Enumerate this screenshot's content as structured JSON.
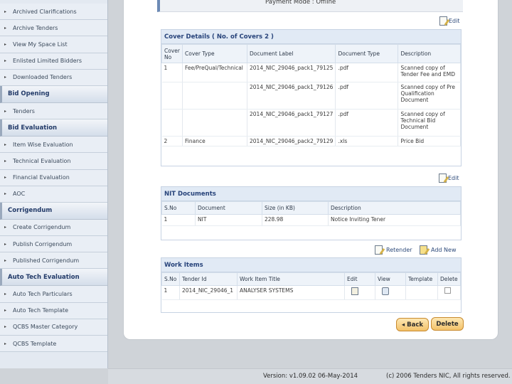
{
  "sidebar": {
    "group1": [
      {
        "label": "Archived Clarifications"
      },
      {
        "label": "Archive Tenders"
      },
      {
        "label": "View My Space List"
      },
      {
        "label": "Enlisted Limited Bidders"
      },
      {
        "label": "Downloaded Tenders"
      }
    ],
    "bid_opening": {
      "heading": "Bid Opening",
      "items": [
        {
          "label": "Tenders"
        }
      ]
    },
    "bid_evaluation": {
      "heading": "Bid Evaluation",
      "items": [
        {
          "label": "Item Wise Evaluation"
        },
        {
          "label": "Technical Evaluation"
        },
        {
          "label": "Financial Evaluation"
        },
        {
          "label": "AOC"
        }
      ]
    },
    "corrigendum": {
      "heading": "Corrigendum",
      "items": [
        {
          "label": "Create Corrigendum"
        },
        {
          "label": "Publish Corrigendum"
        },
        {
          "label": "Published Corrigendum"
        }
      ]
    },
    "auto_tech": {
      "heading": "Auto Tech Evaluation",
      "items": [
        {
          "label": "Auto Tech Particulars"
        },
        {
          "label": "Auto Tech Template"
        },
        {
          "label": "QCBS Master Category"
        },
        {
          "label": "QCBS Template"
        }
      ]
    }
  },
  "payment_mode": "Payment Mode : Offline",
  "cover": {
    "edit_label": "Edit",
    "title": "Cover Details ( No. of Covers 2 )",
    "headers": [
      "Cover No",
      "Cover Type",
      "Document Label",
      "Document Type",
      "Description"
    ],
    "rows": [
      {
        "no": "1",
        "type": "Fee/PreQual/Technical",
        "label": "2014_NIC_29046_pack1_79125",
        "doctype": ".pdf",
        "desc": [
          "Scanned copy of",
          "Tender Fee and EMD"
        ]
      },
      {
        "no": "",
        "type": "",
        "label": "2014_NIC_29046_pack1_79126",
        "doctype": ".pdf",
        "desc": [
          "Scanned copy of Pre",
          "Qualification",
          "Document"
        ]
      },
      {
        "no": "",
        "type": "",
        "label": "2014_NIC_29046_pack1_79127",
        "doctype": ".pdf",
        "desc": [
          "Scanned copy of",
          "Technical Bid",
          "Document"
        ]
      },
      {
        "no": "2",
        "type": "Finance",
        "label": "2014_NIC_29046_pack2_79129",
        "doctype": ".xls",
        "desc": [
          "Price Bid"
        ]
      }
    ]
  },
  "nit": {
    "edit_label": "Edit",
    "title": "NIT Documents",
    "headers": [
      "S.No",
      "Document",
      "Size (in KB)",
      "Description"
    ],
    "rows": [
      {
        "sno": "1",
        "doc": "NIT",
        "size": "228.98",
        "desc": "Notice Inviting Tener"
      }
    ]
  },
  "work": {
    "retender_label": "Retender",
    "addnew_label": "Add New",
    "title": "Work Items",
    "headers": [
      "S.No",
      "Tender Id",
      "Work Item Title",
      "Edit",
      "View",
      "Template",
      "Delete"
    ],
    "rows": [
      {
        "sno": "1",
        "tid": "2014_NIC_29046_1",
        "title": "ANALYSER SYSTEMS"
      }
    ]
  },
  "buttons": {
    "back": "◂ Back",
    "delete": "Delete"
  },
  "footer": {
    "version": "Version: v1.09.02 06-May-2014",
    "copyright": "(c) 2006 Tenders NIC, All rights reserved."
  }
}
